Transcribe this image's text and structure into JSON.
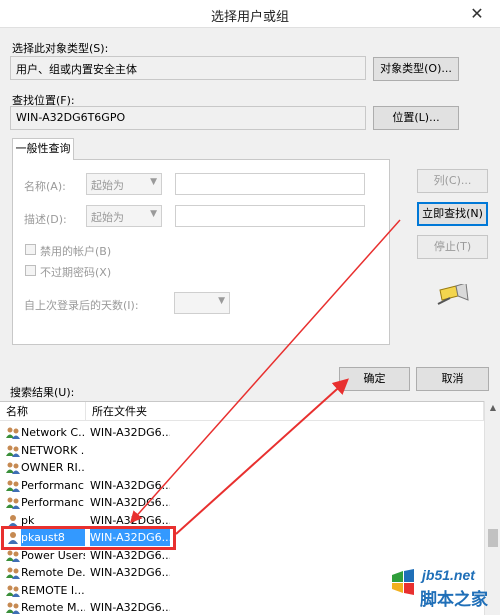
{
  "window": {
    "title": "选择用户或组"
  },
  "object_type": {
    "label": "选择此对象类型(S):",
    "value": "用户、组或内置安全主体",
    "button": "对象类型(O)..."
  },
  "location": {
    "label": "查找位置(F):",
    "value": "WIN-A32DG6T6GPO",
    "button": "位置(L)..."
  },
  "query": {
    "tab": "一般性查询",
    "name_label": "名称(A):",
    "name_mode": "起始为",
    "desc_label": "描述(D):",
    "desc_mode": "起始为",
    "disabled_accounts": "禁用的帐户(B)",
    "non_expiring_pw": "不过期密码(X)",
    "days_since_logon": "自上次登录后的天数(I):"
  },
  "side_buttons": {
    "columns": "列(C)...",
    "find_now": "立即查找(N)",
    "stop": "停止(T)"
  },
  "dialog_buttons": {
    "ok": "确定",
    "cancel": "取消"
  },
  "results": {
    "label": "搜索结果(U):",
    "columns": [
      "名称",
      "所在文件夹"
    ],
    "rows": [
      {
        "name": "Network C...",
        "folder": "WIN-A32DG6...",
        "icon": "group-icon"
      },
      {
        "name": "NETWORK ...",
        "folder": "",
        "icon": "group-icon"
      },
      {
        "name": "OWNER RI...",
        "folder": "",
        "icon": "group-icon"
      },
      {
        "name": "Performanc...",
        "folder": "WIN-A32DG6...",
        "icon": "group-icon"
      },
      {
        "name": "Performanc...",
        "folder": "WIN-A32DG6...",
        "icon": "group-icon"
      },
      {
        "name": "pk",
        "folder": "WIN-A32DG6...",
        "icon": "user-icon"
      },
      {
        "name": "pkaust8",
        "folder": "WIN-A32DG6...",
        "icon": "user-icon",
        "selected": true
      },
      {
        "name": "Power Users",
        "folder": "WIN-A32DG6...",
        "icon": "group-icon"
      },
      {
        "name": "Remote De...",
        "folder": "WIN-A32DG6...",
        "icon": "group-icon"
      },
      {
        "name": "REMOTE I...",
        "folder": "",
        "icon": "group-icon"
      },
      {
        "name": "Remote M...",
        "folder": "WIN-A32DG6...",
        "icon": "group-icon"
      }
    ]
  },
  "watermark": {
    "url": "jb51.net",
    "text": "脚本之家"
  },
  "colors": {
    "accent": "#0078d7",
    "selection": "#3399ff",
    "annotation": "#e8302f"
  }
}
